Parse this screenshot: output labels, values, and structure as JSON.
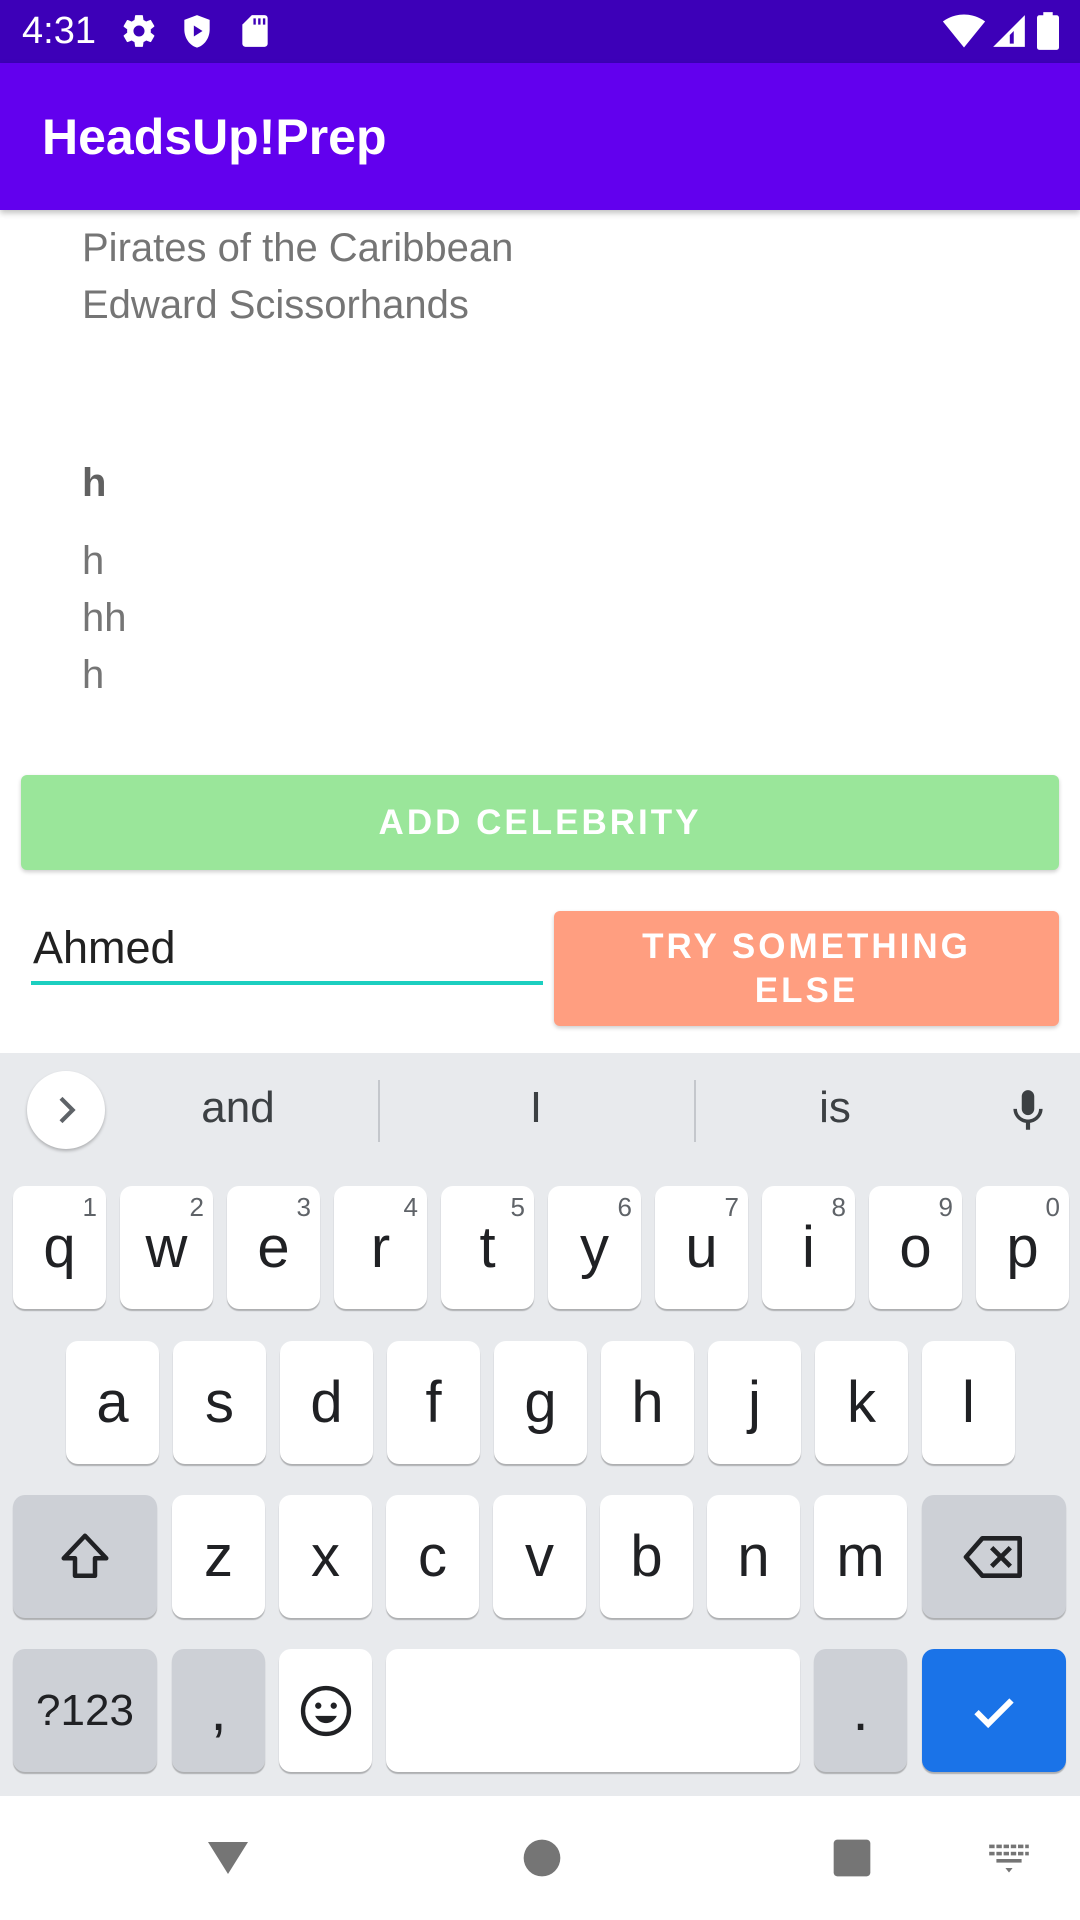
{
  "status_bar": {
    "time": "4:31",
    "left_icons": [
      "gear-icon",
      "shield-play-icon",
      "sd-card-icon"
    ],
    "right_icons": [
      "wifi-icon",
      "signal-icon",
      "battery-icon"
    ]
  },
  "app_bar": {
    "title": "HeadsUp!Prep",
    "color": "#6200ee"
  },
  "content": {
    "list_top": [
      "Pirates of the Caribbean",
      "Edward Scissorhands"
    ],
    "section_title": "h",
    "list_bottom": [
      "h",
      "hh",
      "h"
    ]
  },
  "add_button": {
    "label": "ADD CELEBRITY",
    "color": "#9ae69a"
  },
  "name_input": {
    "value": "Ahmed"
  },
  "try_button": {
    "label": "TRY SOMETHING ELSE",
    "color": "#ff9e80"
  },
  "keyboard": {
    "suggestions": [
      "and",
      "I",
      "is"
    ],
    "row1": [
      {
        "key": "q",
        "hint": "1"
      },
      {
        "key": "w",
        "hint": "2"
      },
      {
        "key": "e",
        "hint": "3"
      },
      {
        "key": "r",
        "hint": "4"
      },
      {
        "key": "t",
        "hint": "5"
      },
      {
        "key": "y",
        "hint": "6"
      },
      {
        "key": "u",
        "hint": "7"
      },
      {
        "key": "i",
        "hint": "8"
      },
      {
        "key": "o",
        "hint": "9"
      },
      {
        "key": "p",
        "hint": "0"
      }
    ],
    "row2": [
      "a",
      "s",
      "d",
      "f",
      "g",
      "h",
      "j",
      "k",
      "l"
    ],
    "row3": [
      "z",
      "x",
      "c",
      "v",
      "b",
      "n",
      "m"
    ],
    "symbols_key": "?123",
    "comma_key": ",",
    "period_key": ".",
    "enter_color": "#1a73e8"
  },
  "nav_bar": {
    "icons": [
      "back-icon",
      "home-icon",
      "recents-icon",
      "keyboard-switch-icon"
    ]
  }
}
